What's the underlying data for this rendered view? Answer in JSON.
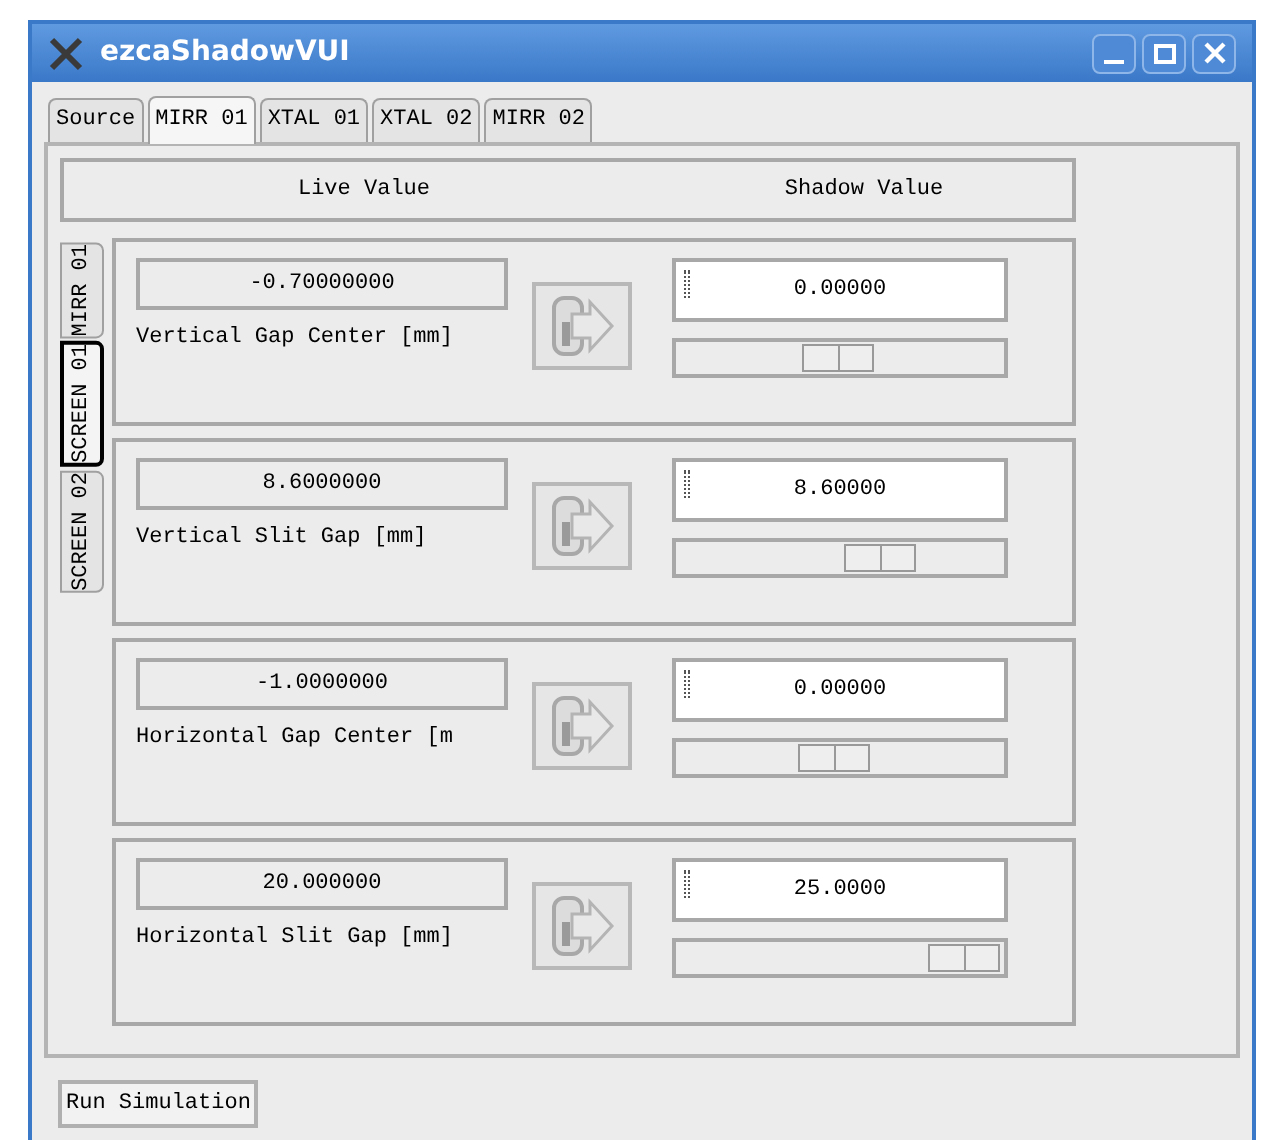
{
  "window": {
    "title": "ezcaShadowVUI"
  },
  "tabs": [
    {
      "label": "Source",
      "selected": false
    },
    {
      "label": "MIRR 01",
      "selected": true
    },
    {
      "label": "XTAL 01",
      "selected": false
    },
    {
      "label": "XTAL 02",
      "selected": false
    },
    {
      "label": "MIRR 02",
      "selected": false
    }
  ],
  "header": {
    "live": "Live Value",
    "shadow": "Shadow Value"
  },
  "side_tabs": [
    {
      "label": "MIRR 01",
      "selected": false
    },
    {
      "label": "SCREEN 01",
      "selected": true
    },
    {
      "label": "SCREEN 02",
      "selected": false
    }
  ],
  "rows": [
    {
      "live": "-0.70000000",
      "label": "Vertical Gap Center [mm]",
      "shadow": "0.00000"
    },
    {
      "live": "8.6000000",
      "label": "Vertical Slit Gap [mm]",
      "shadow": "8.60000"
    },
    {
      "live": "-1.0000000",
      "label": "Horizontal Gap Center [m",
      "shadow": "0.00000"
    },
    {
      "live": "20.000000",
      "label": "Horizontal Slit Gap [mm]",
      "shadow": "25.0000"
    }
  ],
  "run_button": "Run Simulation"
}
